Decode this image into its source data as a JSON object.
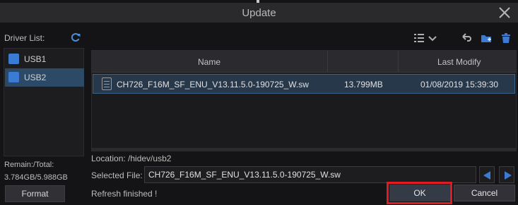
{
  "dialog": {
    "title": "Update"
  },
  "sidebar": {
    "driver_list_label": "Driver List:",
    "drives": [
      {
        "label": "USB1",
        "selected": false
      },
      {
        "label": "USB2",
        "selected": true
      }
    ],
    "remain_total_label": "Remain:/Total:",
    "remain_total_value": "3.784GB/5.988GB",
    "format_label": "Format"
  },
  "toolbar": {
    "icons": [
      "list-view-icon",
      "chevron-down-icon",
      "back-icon",
      "new-folder-icon",
      "delete-icon"
    ]
  },
  "table": {
    "columns": [
      "Name",
      "",
      "Last Modify"
    ],
    "rows": [
      {
        "name": "CH726_F16M_SF_ENU_V13.11.5.0-190725_W.sw",
        "size": "13.799MB",
        "modified": "01/08/2019 15:39:30"
      }
    ]
  },
  "footer": {
    "location": "Location: /hidev/usb2",
    "selected_file_label": "Selected File:",
    "selected_file_value": "CH726_F16M_SF_ENU_V13.11.5.0-190725_W.sw",
    "status": "Refresh finished !",
    "ok_label": "OK",
    "cancel_label": "Cancel"
  },
  "colors": {
    "accent": "#3b7bd4",
    "highlight": "#e01b24",
    "selected_row": "#27384a"
  }
}
